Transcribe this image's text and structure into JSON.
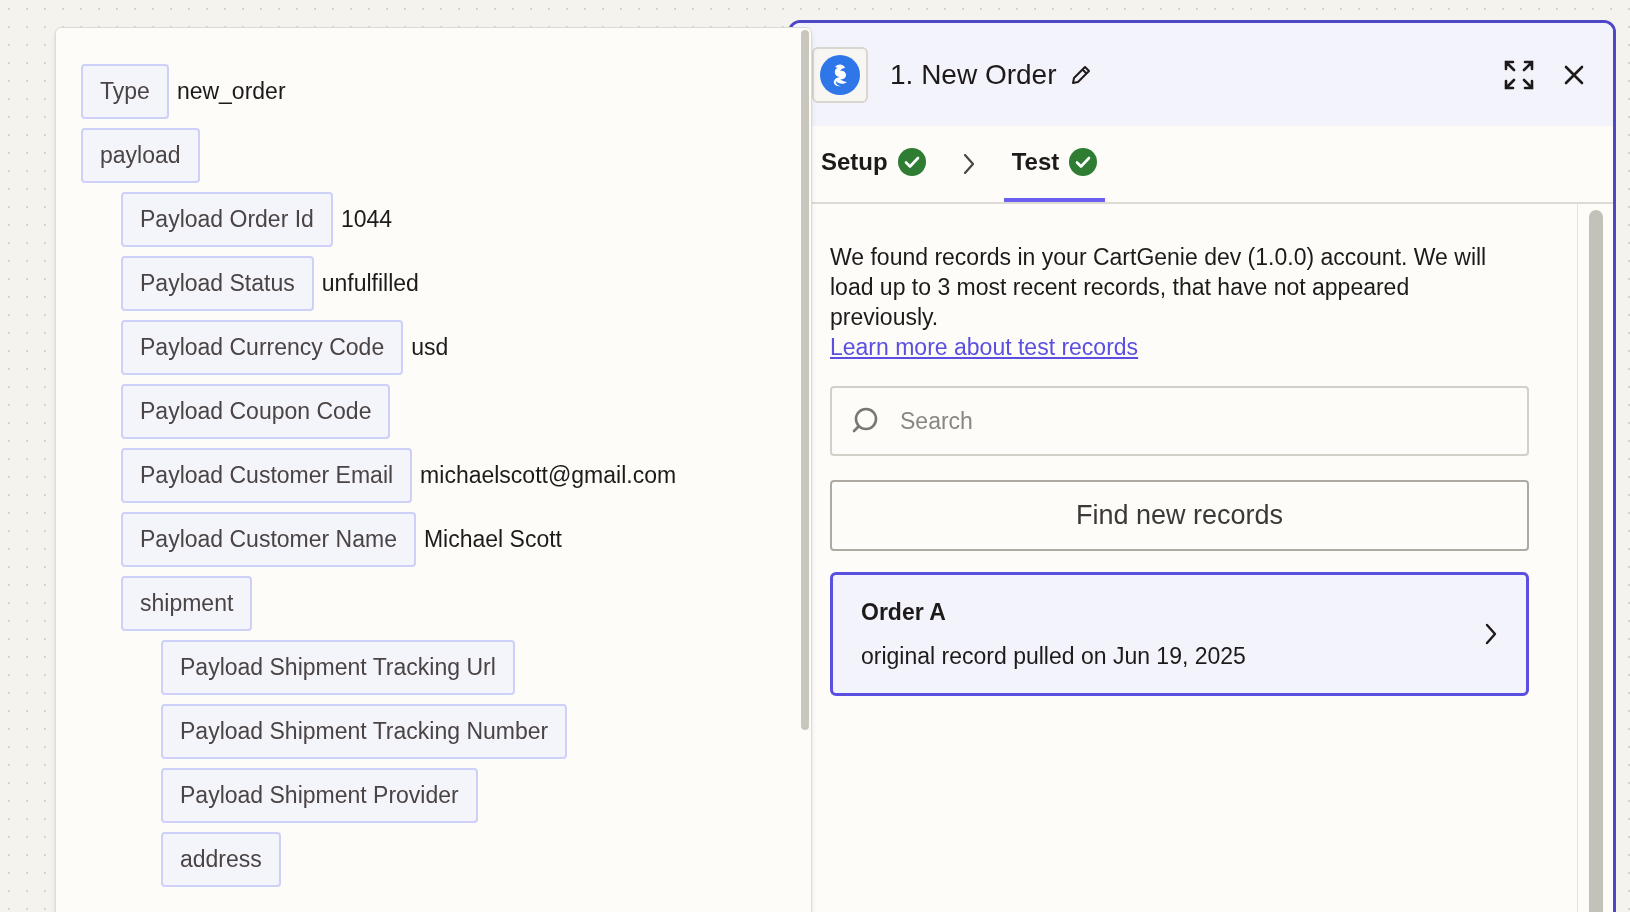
{
  "fields": [
    {
      "label": "Type",
      "value": "new_order"
    },
    {
      "label": "payload",
      "children": [
        {
          "label": "Payload Order Id",
          "value": "1044"
        },
        {
          "label": "Payload Status",
          "value": "unfulfilled"
        },
        {
          "label": "Payload Currency Code",
          "value": "usd"
        },
        {
          "label": "Payload Coupon Code"
        },
        {
          "label": "Payload Customer Email",
          "value": "michaelscott@gmail.com"
        },
        {
          "label": "Payload Customer Name",
          "value": "Michael Scott"
        },
        {
          "label": "shipment",
          "children": [
            {
              "label": "Payload Shipment Tracking Url"
            },
            {
              "label": "Payload Shipment Tracking Number"
            },
            {
              "label": "Payload Shipment Provider"
            },
            {
              "label": "address"
            }
          ]
        }
      ]
    }
  ],
  "step": {
    "title": "1. New Order"
  },
  "tabs": [
    {
      "label": "Setup",
      "completed": true,
      "selected": false
    },
    {
      "label": "Test",
      "completed": true,
      "selected": true
    }
  ],
  "description": "We found records in your CartGenie dev (1.0.0) account. We will load up to 3 most recent records, that have not appeared previously.",
  "learn_more_link": "Learn more about test records",
  "search": {
    "placeholder": "Search"
  },
  "find_button": "Find new records",
  "records": [
    {
      "title": "Order A",
      "subtitle": "original record pulled on Jun 19, 2025",
      "selected": true
    }
  ]
}
